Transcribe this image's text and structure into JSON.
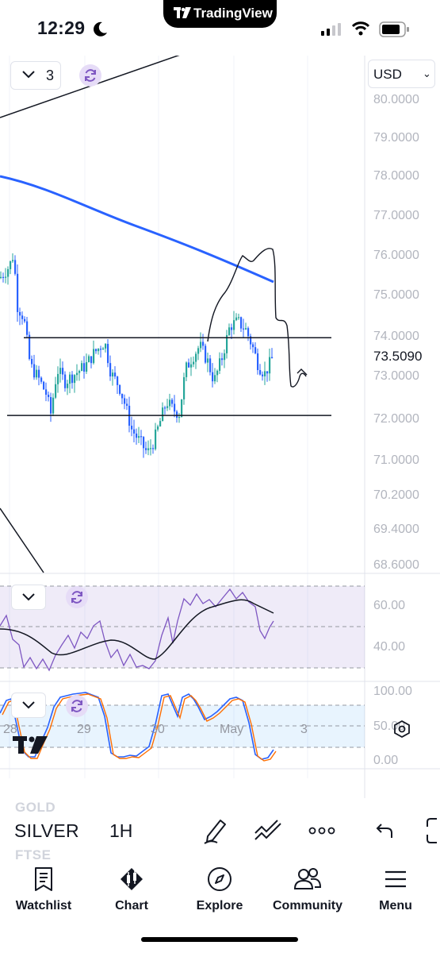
{
  "status_bar": {
    "time": "12:29",
    "app_pill": "TradingView"
  },
  "chart": {
    "interval_value": "3",
    "currency": "USD",
    "price_axis": [
      "80.0000",
      "79.0000",
      "78.0000",
      "77.0000",
      "76.0000",
      "75.0000",
      "74.0000",
      "73.0000",
      "72.0000",
      "71.0000",
      "70.2000",
      "69.4000",
      "68.6000"
    ],
    "current_price": "73.5090",
    "rsi_axis": [
      "60.00",
      "40.00"
    ],
    "stoch_axis": [
      "100.00",
      "50.00",
      "0.00"
    ],
    "time_axis": [
      "28",
      "29",
      "30",
      "May",
      "3"
    ],
    "colors": {
      "up": "#26a69a",
      "down": "#2962ff",
      "ma": "#2962ff",
      "rsi": "#7e57c2",
      "stoch_k": "#2962ff",
      "stoch_d": "#ff6d00"
    }
  },
  "symbol_bar": {
    "ghost_above": "GOLD",
    "symbol": "SILVER",
    "timeframe": "1H",
    "ghost_below": "FTSE",
    "tools": [
      "pen-icon",
      "line-tool-icon",
      "more-icon",
      "undo-icon"
    ]
  },
  "nav": {
    "items": [
      {
        "label": "Watchlist",
        "icon": "watchlist-icon"
      },
      {
        "label": "Chart",
        "icon": "chart-icon"
      },
      {
        "label": "Explore",
        "icon": "compass-icon"
      },
      {
        "label": "Community",
        "icon": "community-icon"
      },
      {
        "label": "Menu",
        "icon": "menu-icon"
      }
    ]
  }
}
